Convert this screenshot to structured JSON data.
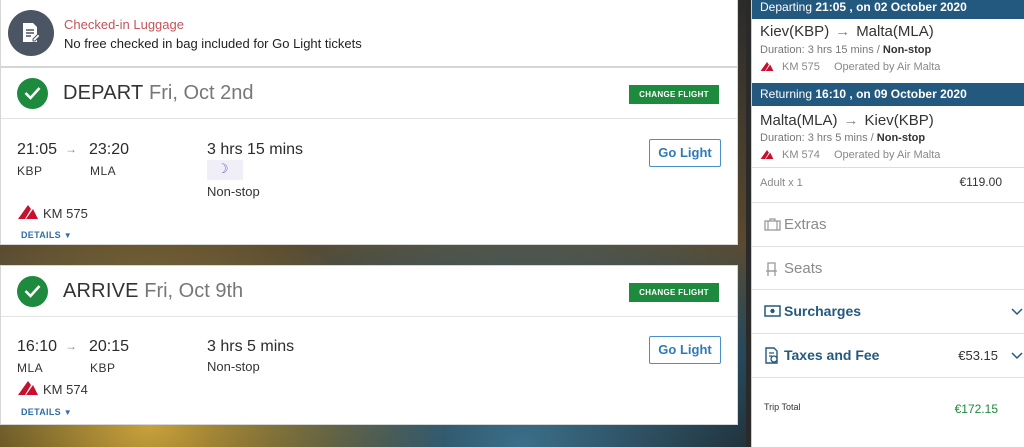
{
  "luggage": {
    "title": "Checked-in Luggage",
    "description": "No free checked in bag included for Go Light tickets"
  },
  "change_flight_label": "CHANGE FLIGHT",
  "details_label": "DETAILS",
  "fare_label": "Go Light",
  "depart": {
    "direction": "DEPART",
    "date": "Fri, Oct 2nd",
    "dep_time": "21:05",
    "dep_code": "KBP",
    "arr_time": "23:20",
    "arr_code": "MLA",
    "duration": "3 hrs 15 mins",
    "stops": "Non-stop",
    "flight_no": "KM 575"
  },
  "arrive": {
    "direction": "ARRIVE",
    "date": "Fri, Oct 9th",
    "dep_time": "16:10",
    "dep_code": "MLA",
    "arr_time": "20:15",
    "arr_code": "KBP",
    "duration": "3 hrs 5 mins",
    "stops": "Non-stop",
    "flight_no": "KM 574"
  },
  "summary": {
    "outbound": {
      "header_prefix": "Departing",
      "header_time": "21:05 , on 02 October 2020",
      "from": "Kiev(KBP)",
      "to": "Malta(MLA)",
      "duration_prefix": "Duration: 3 hrs 15 mins /",
      "stops": "Non-stop",
      "flight_no": "KM 575",
      "operated_by": "Operated by Air Malta"
    },
    "inbound": {
      "header_prefix": "Returning",
      "header_time": "16:10 , on 09 October 2020",
      "from": "Malta(MLA)",
      "to": "Kiev(KBP)",
      "duration_prefix": "Duration: 3 hrs 5 mins /",
      "stops": "Non-stop",
      "flight_no": "KM 574",
      "operated_by": "Operated by Air Malta"
    },
    "passengers": "Adult x 1",
    "base_price": "€119.00",
    "extras_label": "Extras",
    "seats_label": "Seats",
    "surcharges_label": "Surcharges",
    "taxes_label": "Taxes and Fee",
    "taxes_amount": "€53.15",
    "trip_total_label": "Trip Total",
    "trip_total": "€172.15"
  },
  "colors": {
    "brand_blue": "#24597f",
    "success_green": "#1d8a3d",
    "luggage_red": "#c5535a"
  }
}
